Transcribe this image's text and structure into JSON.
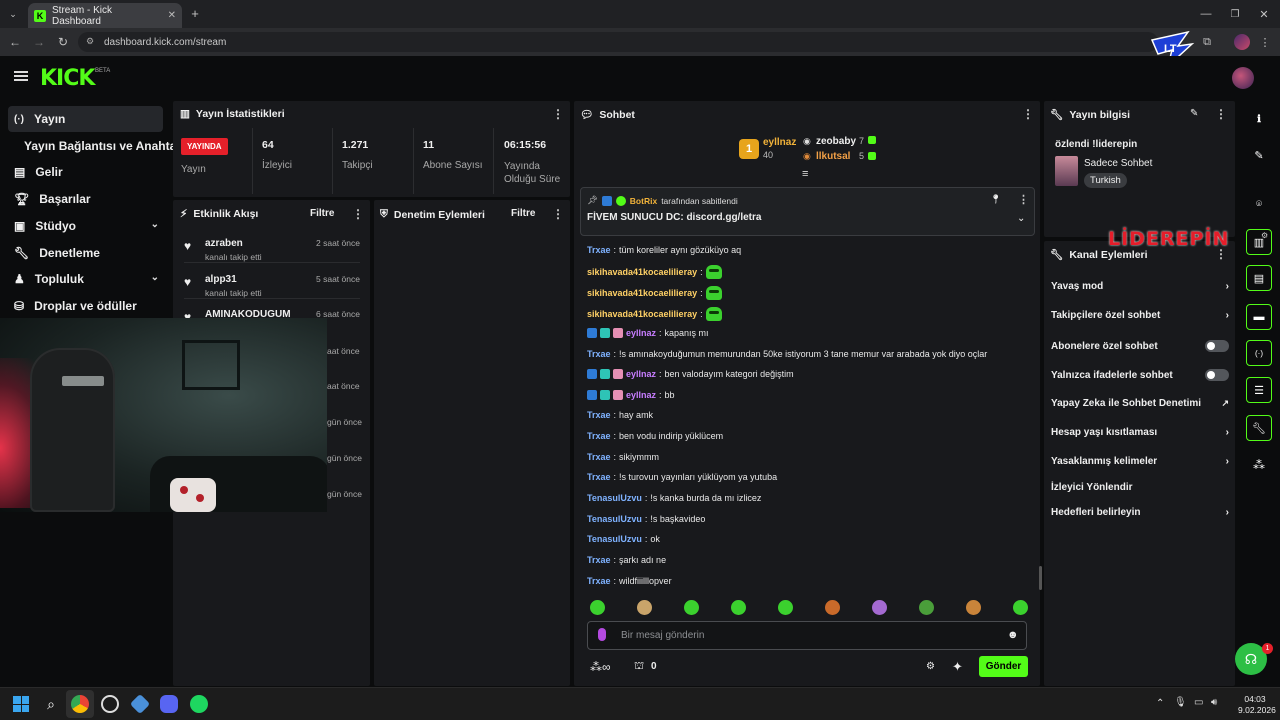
{
  "browser": {
    "tab_title": "Stream - Kick Dashboard",
    "url": "dashboard.kick.com/stream",
    "new_tab": "+"
  },
  "kick": {
    "logo": "KICK",
    "beta": "BETA"
  },
  "sidebar": {
    "items": [
      {
        "label": "Yayın",
        "icon": "broadcast-icon"
      },
      {
        "label": "Yayın Bağlantısı ve Anahtarı"
      },
      {
        "label": "Gelir",
        "icon": "revenue-icon"
      },
      {
        "label": "Başarılar",
        "icon": "trophy-icon"
      },
      {
        "label": "Stüdyo",
        "icon": "studio-icon"
      },
      {
        "label": "Denetleme",
        "icon": "wrench-icon"
      },
      {
        "label": "Topluluk",
        "icon": "community-icon"
      },
      {
        "label": "Droplar ve ödüller",
        "icon": "drops-icon"
      }
    ]
  },
  "stats": {
    "title": "Yayın İstatistikleri",
    "live_badge": "YAYINDA",
    "live_label": "Yayın",
    "cols": [
      {
        "value": "64",
        "label": "İzleyici"
      },
      {
        "value": "1.271",
        "label": "Takipçi"
      },
      {
        "value": "11",
        "label": "Abone Sayısı"
      },
      {
        "value": "06:15:56",
        "label": "Yayında Olduğu Süre"
      }
    ]
  },
  "activity": {
    "title": "Etkinlik Akışı",
    "filter": "Filtre",
    "items": [
      {
        "name": "azraben",
        "sub": "kanalı takip etti",
        "time": "2 saat önce"
      },
      {
        "name": "alpp31",
        "sub": "kanalı takip etti",
        "time": "5 saat önce"
      },
      {
        "name": "AMINAKODUGUM",
        "sub": "",
        "time": "6 saat önce"
      }
    ],
    "partial_times": [
      "aat önce",
      "aat önce",
      "gün önce",
      "gün önce",
      "gün önce"
    ]
  },
  "moderation": {
    "title": "Denetim Eylemleri",
    "filter": "Filtre"
  },
  "chat": {
    "title": "Sohbet",
    "leaders": [
      {
        "name": "eyllnaz",
        "count": "40",
        "rank": "1"
      },
      {
        "name": "zeobaby",
        "count": "7"
      },
      {
        "name": "llkutsal",
        "count": "5"
      }
    ],
    "pinned": {
      "by": "BotRix",
      "by_suffix": "tarafından sabitlendi",
      "text": "FİVEM SUNUCU DC: discord.gg/letra"
    },
    "messages": [
      {
        "user": "Trxae",
        "color": "#7fb2ff",
        "text": "tüm koreliler aynı gözüküyo aq"
      },
      {
        "user": "sikihavada41kocaelilieray",
        "color": "#ffd166",
        "text": "",
        "emote": true
      },
      {
        "user": "sikihavada41kocaelilieray",
        "color": "#ffd166",
        "text": "",
        "emote": true
      },
      {
        "user": "sikihavada41kocaelilieray",
        "color": "#ffd166",
        "text": "",
        "emote": true
      },
      {
        "user": "eyllnaz",
        "color": "#c77dff",
        "text": "kapanış mı",
        "badges": true
      },
      {
        "user": "Trxae",
        "color": "#7fb2ff",
        "text": "!s amınakoyduğumun memurundan 50ke istiyorum 3 tane memur var arabada yok diyo oçlar"
      },
      {
        "user": "eyllnaz",
        "color": "#c77dff",
        "text": "ben valodayım kategori değiştim",
        "badges": true
      },
      {
        "user": "eyllnaz",
        "color": "#c77dff",
        "text": "bb",
        "badges": true
      },
      {
        "user": "Trxae",
        "color": "#7fb2ff",
        "text": "hay amk"
      },
      {
        "user": "Trxae",
        "color": "#7fb2ff",
        "text": "ben vodu indirip yüklücem"
      },
      {
        "user": "Trxae",
        "color": "#7fb2ff",
        "text": "sikiymmm"
      },
      {
        "user": "Trxae",
        "color": "#7fb2ff",
        "text": "!s turovun yayınları yüklüyom ya yutuba"
      },
      {
        "user": "TenasulUzvu",
        "color": "#7fb2ff",
        "text": "!s kanka burda da mı izlicez"
      },
      {
        "user": "TenasulUzvu",
        "color": "#7fb2ff",
        "text": "!s başkavideo"
      },
      {
        "user": "TenasulUzvu",
        "color": "#7fb2ff",
        "text": "ok"
      },
      {
        "user": "Trxae",
        "color": "#7fb2ff",
        "text": "şarkı adı ne"
      },
      {
        "user": "Trxae",
        "color": "#7fb2ff",
        "text": "wildfiiilllopver"
      }
    ],
    "input_placeholder": "Bir mesaj gönderin",
    "points": "0",
    "send": "Gönder"
  },
  "stream_info": {
    "title": "Yayın bilgisi",
    "stream_title": "özlendi !liderepin",
    "category": "Sadece Sohbet",
    "tag": "Turkish"
  },
  "channel_actions": {
    "title": "Kanal Eylemleri",
    "watermark": "LİDEREPİN",
    "items": [
      {
        "label": "Yavaş mod",
        "kind": "chevron"
      },
      {
        "label": "Takipçilere özel sohbet",
        "kind": "chevron"
      },
      {
        "label": "Abonelere özel sohbet",
        "kind": "toggle"
      },
      {
        "label": "Yalnızca ifadelerle sohbet",
        "kind": "toggle"
      },
      {
        "label": "Yapay Zeka ile Sohbet Denetimi",
        "kind": "external"
      },
      {
        "label": "Hesap yaşı kısıtlaması",
        "kind": "chevron"
      },
      {
        "label": "Yasaklanmış kelimeler",
        "kind": "chevron"
      },
      {
        "label": "İzleyici Yönlendir",
        "kind": "none"
      },
      {
        "label": "Hedefleri belirleyin",
        "kind": "chevron"
      }
    ]
  },
  "taskbar": {
    "time": "04:03",
    "date": "9.02.2026"
  },
  "colors": {
    "kick_green": "#53fc18",
    "live_red": "#e5202a",
    "panel": "#18191c"
  }
}
